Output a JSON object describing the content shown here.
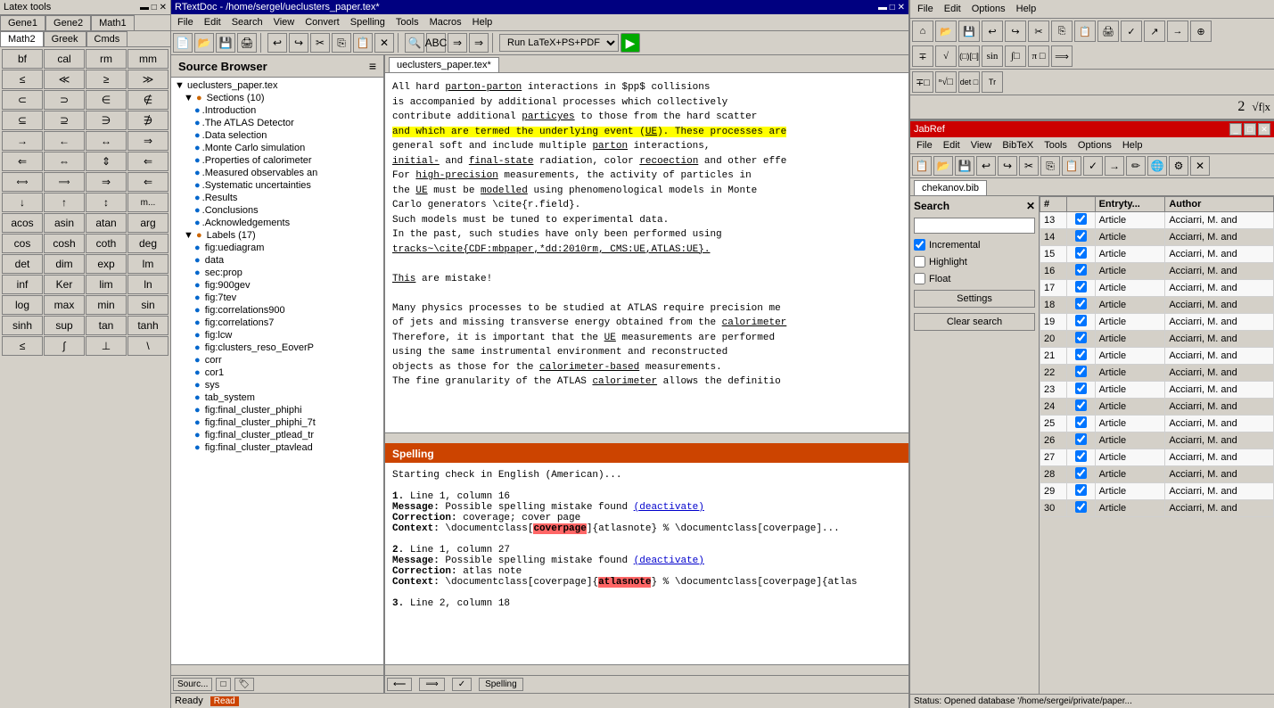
{
  "latex_tools": {
    "title": "Latex tools",
    "tabs": [
      {
        "label": "Gene1",
        "active": false
      },
      {
        "label": "Gene2",
        "active": false
      },
      {
        "label": "Math1",
        "active": false
      },
      {
        "label": "Math2",
        "active": true
      },
      {
        "label": "Greek",
        "active": false
      },
      {
        "label": "Cmds",
        "active": false
      }
    ],
    "buttons": [
      "bf",
      "cal",
      "rm",
      "mm",
      "≤",
      "≪",
      "≥",
      "≫",
      "⊂",
      "⊃",
      "∈",
      "∉",
      "⊆",
      "⊇",
      "∋",
      "∌",
      "→",
      "←",
      "↔",
      "⇒",
      "⇐",
      "⇔",
      "⇕",
      "⇐",
      "⟺",
      "⟹",
      "⇒",
      "⇐",
      "↓",
      "↑",
      "↕",
      "m...",
      "acos",
      "asin",
      "atan",
      "arg",
      "cos",
      "cosh",
      "coth",
      "deg",
      "det",
      "dim",
      "exp",
      "lm",
      "inf",
      "Ker",
      "lim",
      "ln",
      "log",
      "max",
      "min",
      "sin",
      "sinh",
      "sup",
      "tan",
      "tanh",
      "≤",
      "∫",
      "⊥",
      "\\"
    ]
  },
  "editor": {
    "titlebar": "RTextDoc - /home/sergel/ueclusters_paper.tex*",
    "menu_items": [
      "File",
      "Edit",
      "Search",
      "View",
      "Convert",
      "Spelling",
      "Tools",
      "Macros",
      "Help"
    ],
    "tab_label": "ueclusters_paper.tex*",
    "run_option": "Run LaTeX+PS+PDF",
    "content_lines": [
      "All hard parton-parton interactions in $pp$ collisions",
      "is accompanied by additional processes which collectively",
      "contribute additional particyes to those from the hard scatter",
      "and which are termed the underlying event (UE). These processes are",
      "general soft and include multiple parton interactions,",
      "initial- and final-state radiation, color recoection and other effe",
      "For high-precision measurements,  the activity of  particles in",
      "the UE must be modelled  using phenomenological models in Monte",
      "Carlo generators \\cite{r.field}.",
      "Such models must be tuned to experimental data.",
      "In the past, such studies have only been performed using",
      "tracks~\\cite{CDF:mbpaper,*dd:2010rm, CMS:UE,ATLAS:UE}.",
      "",
      "This are mistake!",
      "",
      "Many physics processes to be studied at ATLAS require precision me",
      "of jets and missing transverse energy obtained from the calorimeter",
      "Therefore, it is important that the UE measurements are performed",
      "using the same instrumental environment and reconstructed",
      "objects as those for the calorimeter-based measurements.",
      "The fine granularity of the ATLAS calorimeter allows the definitio"
    ]
  },
  "source_browser": {
    "title": "Source Browser",
    "root": "ueclusters_paper.tex",
    "sections_label": "Sections (10)",
    "sections": [
      ".Introduction",
      ".The ATLAS Detector",
      ".Data selection",
      ".Monte Carlo simulation",
      ".Properties of calorimeter",
      ".Measured observables an",
      ".Systematic uncertainties",
      ".Results",
      ".Conclusions",
      ".Acknowledgements"
    ],
    "labels_label": "Labels (17)",
    "labels": [
      "fig:uediagram",
      "data",
      "sec:prop",
      "fig:900gev",
      "fig:7tev",
      "fig:correlations900",
      "fig:correlations7",
      "fig:lcw",
      "fig:clusters_reso_EoverP",
      "corr",
      "cor1",
      "sys",
      "tab_system",
      "fig:final_cluster_phiphi",
      "fig:final_cluster_phiphi_7t",
      "fig:final_cluster_ptlead_tr",
      "fig:final_cluster_ptavlead"
    ],
    "bottom_label": "Sourc..."
  },
  "spelling": {
    "title": "Spelling",
    "starting_msg": "Starting check in English (American)...",
    "entries": [
      {
        "num": "1.",
        "line_col": "Line 1, column 16",
        "message": "Possible spelling mistake found",
        "correction": "coverage; cover page",
        "context": "\\documentclass[coverpage]{atlasnote} % \\documentclass[coverpage]..."
      },
      {
        "num": "2.",
        "line_col": "Line 1, column 27",
        "message": "Possible spelling mistake found",
        "correction": "atlas note",
        "context": "\\documentclass[coverpage]{atlasnote} % \\documentclass[coverpage]{atlas"
      },
      {
        "num": "3.",
        "line_col": "Line 2, column 18",
        "message": "",
        "correction": "",
        "context": ""
      }
    ]
  },
  "jabref": {
    "title": "JabRef",
    "menu_items": [
      "File",
      "Edit",
      "View",
      "BibTeX",
      "Tools",
      "Options",
      "Help"
    ],
    "tab_label": "chekanov.bib",
    "search": {
      "label": "Search",
      "placeholder": "",
      "clear_btn": "✕",
      "incremental_label": "Incremental",
      "highlight_label": "Highlight",
      "float_label": "Float",
      "settings_btn": "Settings",
      "clear_search_btn": "Clear search"
    },
    "table_headers": [
      "#",
      "",
      "Entryty...",
      "Author"
    ],
    "rows": [
      {
        "num": "13",
        "check": true,
        "type": "Article",
        "author": "Acciarri, M. and"
      },
      {
        "num": "14",
        "check": true,
        "type": "Article",
        "author": "Acciarri, M. and"
      },
      {
        "num": "15",
        "check": true,
        "type": "Article",
        "author": "Acciarri, M. and"
      },
      {
        "num": "16",
        "check": true,
        "type": "Article",
        "author": "Acciarri, M. and"
      },
      {
        "num": "17",
        "check": true,
        "type": "Article",
        "author": "Acciarri, M. and"
      },
      {
        "num": "18",
        "check": true,
        "type": "Article",
        "author": "Acciarri, M. and"
      },
      {
        "num": "19",
        "check": true,
        "type": "Article",
        "author": "Acciarri, M. and"
      },
      {
        "num": "20",
        "check": true,
        "type": "Article",
        "author": "Acciarri, M. and"
      },
      {
        "num": "21",
        "check": true,
        "type": "Article",
        "author": "Acciarri, M. and"
      },
      {
        "num": "22",
        "check": true,
        "type": "Article",
        "author": "Acciarri, M. and"
      },
      {
        "num": "23",
        "check": true,
        "type": "Article",
        "author": "Acciarri, M. and"
      },
      {
        "num": "24",
        "check": true,
        "type": "Article",
        "author": "Acciarri, M. and"
      },
      {
        "num": "25",
        "check": true,
        "type": "Article",
        "author": "Acciarri, M. and"
      },
      {
        "num": "26",
        "check": true,
        "type": "Article",
        "author": "Acciarri, M. and"
      },
      {
        "num": "27",
        "check": true,
        "type": "Article",
        "author": "Acciarri, M. and"
      },
      {
        "num": "28",
        "check": true,
        "type": "Article",
        "author": "Acciarri, M. and"
      },
      {
        "num": "29",
        "check": true,
        "type": "Article",
        "author": "Acciarri, M. and"
      },
      {
        "num": "30",
        "check": true,
        "type": "Article",
        "author": "Acciarri, M. and"
      }
    ],
    "status": "Status: Opened database '/home/sergei/private/paper..."
  },
  "math_toolbar": {
    "menu_items": [
      "File",
      "Edit",
      "Options",
      "Help"
    ],
    "special_items": [
      "2",
      "√f|x"
    ]
  },
  "statusbar": {
    "ready": "Ready",
    "indicator": "Read"
  }
}
